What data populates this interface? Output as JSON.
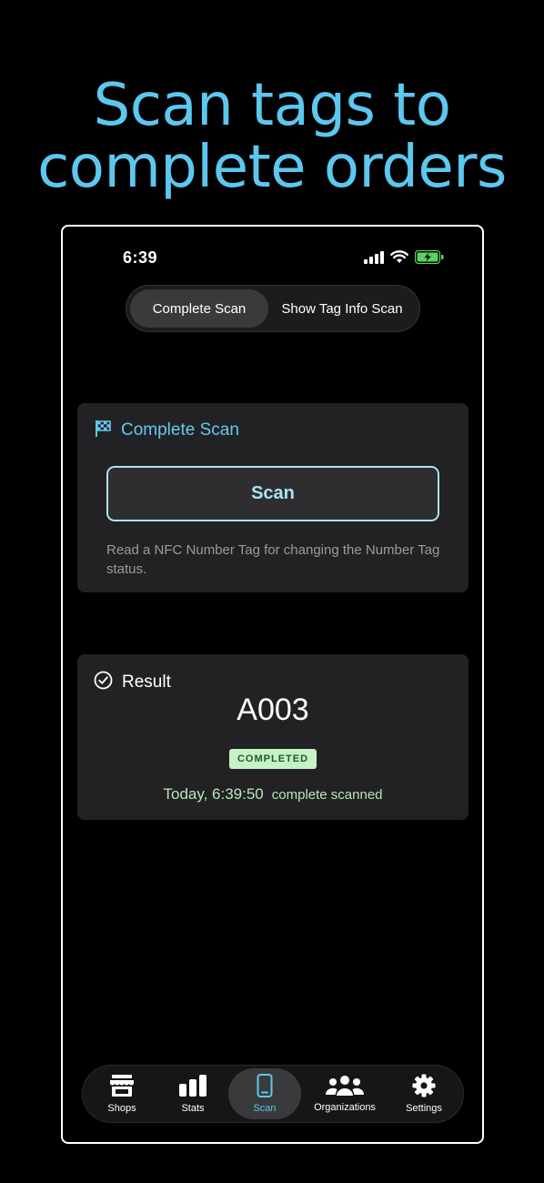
{
  "headline": {
    "line1": "Scan tags to",
    "line2": "complete orders"
  },
  "status_bar": {
    "time": "6:39"
  },
  "segmented_control": {
    "options": [
      "Complete Scan",
      "Show Tag Info Scan"
    ],
    "selected": "Complete Scan"
  },
  "scan_card": {
    "title": "Complete Scan",
    "icon": "flag-checkered-icon",
    "button_label": "Scan",
    "description": "Read a NFC Number Tag for changing the Number Tag status."
  },
  "result_card": {
    "title": "Result",
    "icon": "checkmark-circle-icon",
    "tag_number": "A003",
    "status_badge": "COMPLETED",
    "timestamp": "Today, 6:39:50",
    "note": "complete scanned"
  },
  "tab_bar": {
    "items": [
      {
        "label": "Shops",
        "icon": "shop-icon"
      },
      {
        "label": "Stats",
        "icon": "bar-chart-icon"
      },
      {
        "label": "Scan",
        "icon": "phone-scan-icon"
      },
      {
        "label": "Organizations",
        "icon": "people-icon"
      },
      {
        "label": "Settings",
        "icon": "gear-icon"
      }
    ],
    "active": "Scan"
  },
  "colors": {
    "accent": "#5cc8f0",
    "badge_bg": "#c5f2c7",
    "badge_text": "#1d5a23",
    "success_text": "#b6e7b8"
  }
}
